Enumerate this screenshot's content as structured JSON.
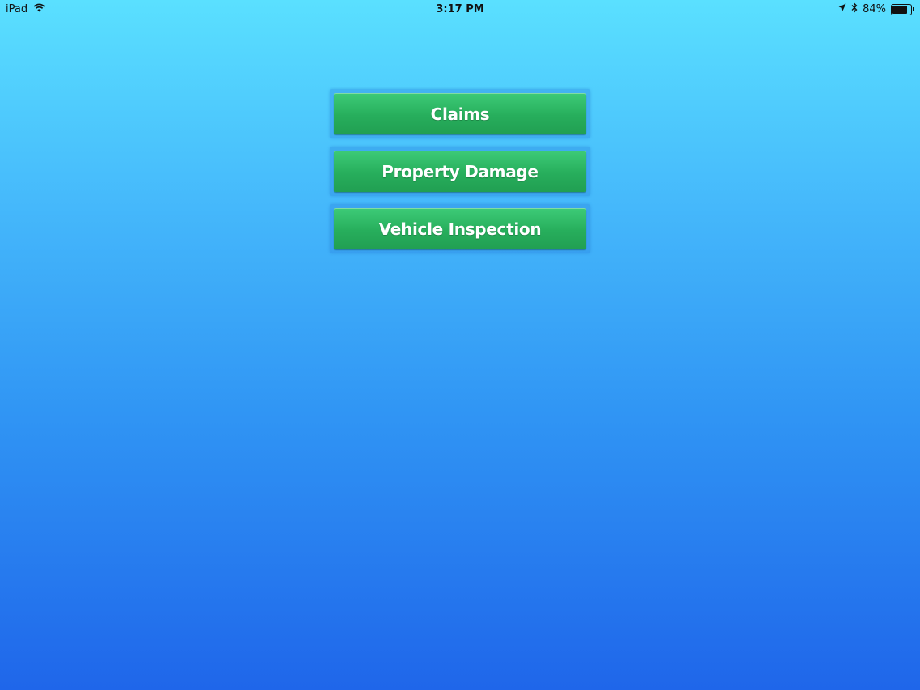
{
  "status_bar": {
    "device": "iPad",
    "time": "3:17 PM",
    "battery_percent": "84%",
    "battery_level": 0.84,
    "icons": [
      "wifi-icon",
      "location-arrow-icon",
      "bluetooth-icon",
      "battery-icon"
    ]
  },
  "menu": {
    "items": [
      {
        "label": "Claims"
      },
      {
        "label": "Property Damage"
      },
      {
        "label": "Vehicle Inspection"
      }
    ],
    "button_color": "#27ae5c"
  },
  "colors": {
    "background_top": "#5ae0ff",
    "background_bottom": "#1f66ea"
  }
}
